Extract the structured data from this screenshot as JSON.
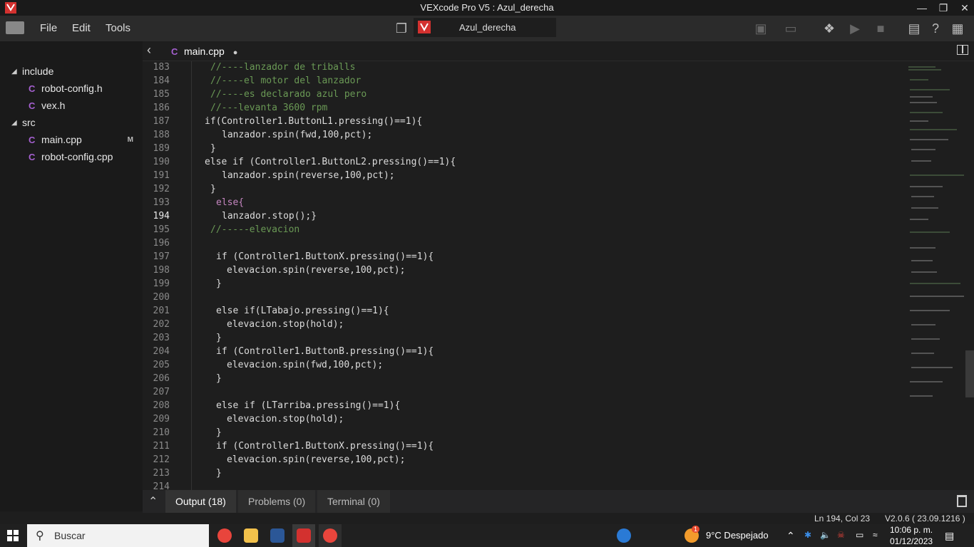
{
  "window": {
    "title": "VEXcode Pro V5 : Azul_derecha"
  },
  "menu": {
    "file": "File",
    "edit": "Edit",
    "tools": "Tools"
  },
  "project": {
    "name": "Azul_derecha"
  },
  "sidebar": {
    "folders": [
      {
        "label": "include",
        "files": [
          {
            "label": "robot-config.h",
            "badge": ""
          },
          {
            "label": "vex.h",
            "badge": ""
          }
        ]
      },
      {
        "label": "src",
        "files": [
          {
            "label": "main.cpp",
            "badge": "M"
          },
          {
            "label": "robot-config.cpp",
            "badge": ""
          }
        ]
      }
    ]
  },
  "editor": {
    "tab_label": "main.cpp",
    "modified_dot": "●"
  },
  "code_lines": [
    {
      "n": "183",
      "t": "//----lanzador de triballs"
    },
    {
      "n": "184",
      "t": "//----el motor del lanzador"
    },
    {
      "n": "185",
      "t": "//----es declarado azul pero"
    },
    {
      "n": "186",
      "t": "//---levanta 3600 rpm"
    },
    {
      "n": "187",
      "t": "if(Controller1.ButtonL1.pressing()==1){"
    },
    {
      "n": "188",
      "t": "lanzador.spin(fwd,100,pct);"
    },
    {
      "n": "189",
      "t": "}"
    },
    {
      "n": "190",
      "t": "else if (Controller1.ButtonL2.pressing()==1){"
    },
    {
      "n": "191",
      "t": "lanzador.spin(reverse,100,pct);"
    },
    {
      "n": "192",
      "t": "}"
    },
    {
      "n": "193",
      "t": "else{"
    },
    {
      "n": "194",
      "t": "lanzador.stop();}"
    },
    {
      "n": "195",
      "t": "//-----elevacion"
    },
    {
      "n": "196",
      "t": ""
    },
    {
      "n": "197",
      "t": "if (Controller1.ButtonX.pressing()==1){"
    },
    {
      "n": "198",
      "t": "elevacion.spin(reverse,100,pct);"
    },
    {
      "n": "199",
      "t": "}"
    },
    {
      "n": "200",
      "t": ""
    },
    {
      "n": "201",
      "t": "else if(LTabajo.pressing()==1){"
    },
    {
      "n": "202",
      "t": "elevacion.stop(hold);"
    },
    {
      "n": "203",
      "t": "}"
    },
    {
      "n": "204",
      "t": "if (Controller1.ButtonB.pressing()==1){"
    },
    {
      "n": "205",
      "t": "elevacion.spin(fwd,100,pct);"
    },
    {
      "n": "206",
      "t": "}"
    },
    {
      "n": "207",
      "t": ""
    },
    {
      "n": "208",
      "t": "else if (LTarriba.pressing()==1){"
    },
    {
      "n": "209",
      "t": "elevacion.stop(hold);"
    },
    {
      "n": "210",
      "t": "}"
    },
    {
      "n": "211",
      "t": "if (Controller1.ButtonX.pressing()==1){"
    },
    {
      "n": "212",
      "t": "elevacion.spin(reverse,100,pct);"
    },
    {
      "n": "213",
      "t": "}"
    },
    {
      "n": "214",
      "t": ""
    }
  ],
  "panel": {
    "output": "Output (18)",
    "problems": "Problems (0)",
    "terminal": "Terminal (0)"
  },
  "status": {
    "cursor": "Ln 194, Col 23",
    "version": "V2.0.6 ( 23.09.1216 )"
  },
  "taskbar": {
    "search": "Buscar",
    "weather": "9°C  Despejado",
    "weather_badge": "1",
    "time": "10:06 p. m.",
    "date": "01/12/2023"
  },
  "colors": {
    "accent": "#d3312f",
    "comment": "#6a9955",
    "keyword": "#c586c0",
    "function": "#dcdcaa",
    "property": "#4fc1ff",
    "number": "#b5cea8"
  }
}
